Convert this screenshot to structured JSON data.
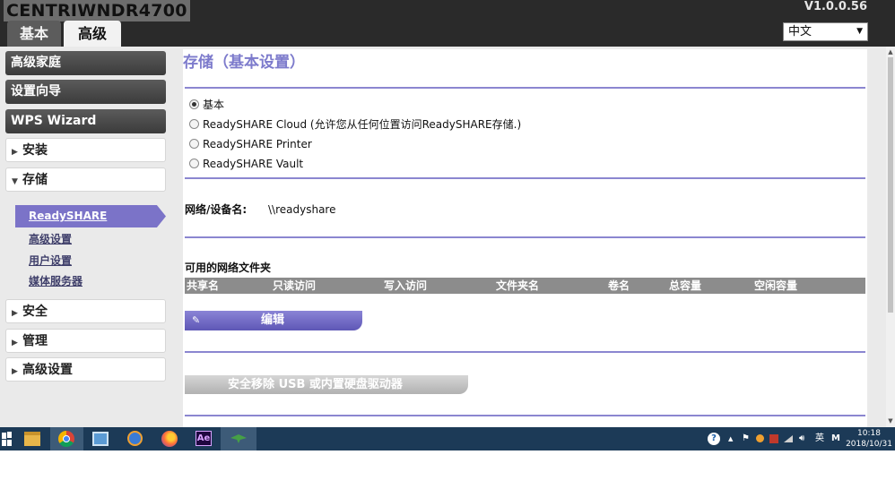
{
  "header": {
    "model": "CENTRIWNDR4700",
    "version": "V1.0.0.56",
    "tabs": [
      {
        "label": "基本"
      },
      {
        "label": "高级"
      }
    ],
    "language": "中文"
  },
  "sidebar": {
    "dark_items": [
      {
        "label": "高级家庭"
      },
      {
        "label": "设置向导"
      },
      {
        "label": "WPS Wizard"
      }
    ],
    "install": "安装",
    "storage": "存储",
    "storage_sub": {
      "active": "ReadySHARE",
      "items": [
        {
          "label": "高级设置"
        },
        {
          "label": "用户设置"
        },
        {
          "label": "媒体服务器"
        }
      ]
    },
    "security": "安全",
    "manage": "管理",
    "advanced_settings": "高级设置"
  },
  "main": {
    "title": "存储（基本设置）",
    "options": [
      {
        "label": "基本",
        "checked": true
      },
      {
        "label": "ReadySHARE Cloud (允许您从任何位置访问ReadySHARE存储.)",
        "checked": false
      },
      {
        "label": "ReadySHARE Printer",
        "checked": false
      },
      {
        "label": "ReadySHARE Vault",
        "checked": false
      }
    ],
    "device_label": "网络/设备名:",
    "device_value": "\\\\readyshare",
    "folders_title": "可用的网络文件夹",
    "columns": [
      "共享名",
      "只读访问",
      "写入访问",
      "文件夹名",
      "卷名",
      "总容量",
      "空闲容量"
    ],
    "edit_label": "编辑",
    "safe_remove_label": "安全移除 USB 或内置硬盘驱动器"
  },
  "taskbar": {
    "tray_lang": "英",
    "tray_ime": "M",
    "time": "10:18",
    "date": "2018/10/31",
    "app_ae": "Ae"
  },
  "colors": {
    "accent": "#7b73c8",
    "header_bg": "#2a2a2a",
    "taskbar_bg": "#1c3a57"
  }
}
